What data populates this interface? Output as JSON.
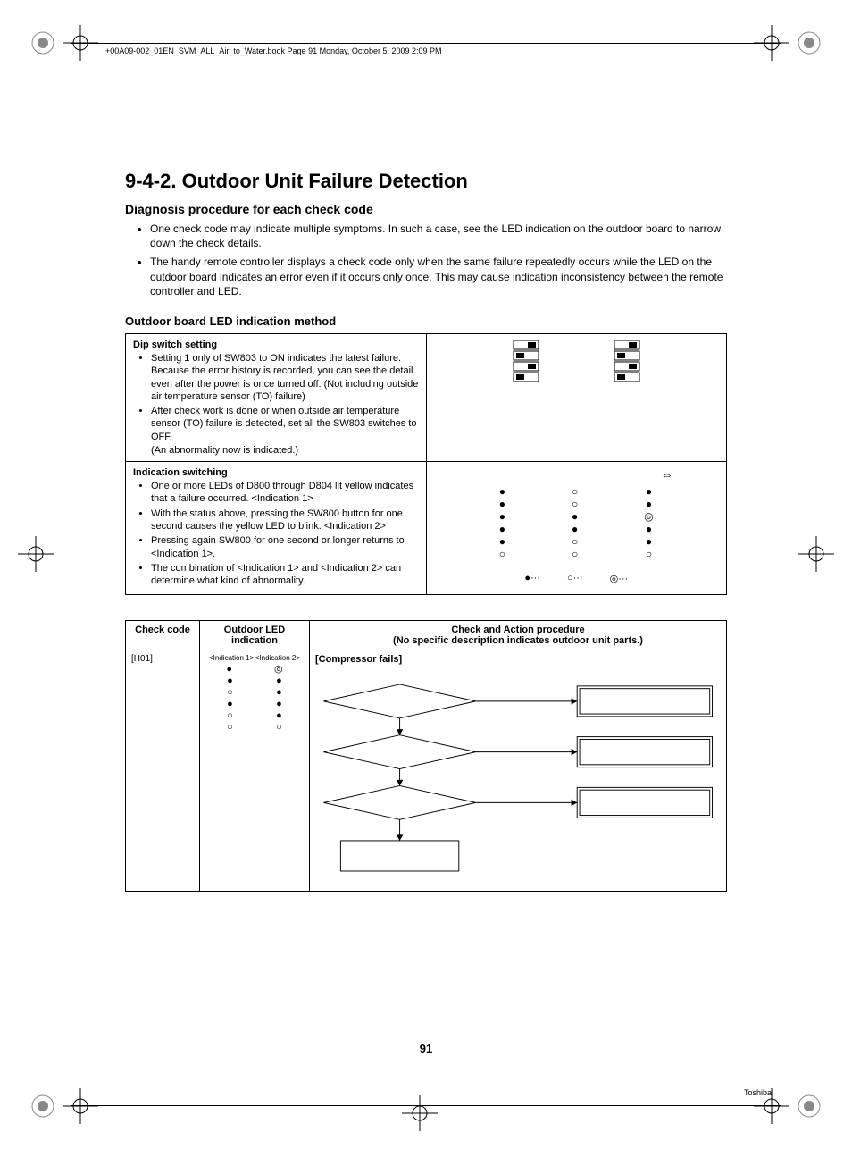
{
  "header_text": "+00A09-002_01EN_SVM_ALL_Air_to_Water.book  Page 91  Monday, October 5, 2009  2:09 PM",
  "section_number": "9-4-2.",
  "section_title": "Outdoor Unit Failure Detection",
  "subtitle": "Diagnosis procedure for each check code",
  "bullets": [
    "One check code may indicate multiple symptoms. In such a case, see the LED indication on the outdoor board to narrow down the check details.",
    "The handy remote controller displays a check code only when the same failure repeatedly occurs while the LED on the outdoor board indicates an error even if it occurs only once. This may cause indication inconsistency between the remote controller and LED."
  ],
  "outdoor_heading": "Outdoor board LED indication method",
  "dip": {
    "title": "Dip switch setting",
    "items": [
      "Setting 1 only of SW803 to ON indicates the latest failure. Because the error history is recorded, you can see the detail even after the power is once turned off. (Not including outside air temperature sensor (TO) failure)",
      "After check work is done or when outside air temperature sensor (TO) failure is detected, set all the SW803 switches to OFF.",
      "(An abnormality now is indicated.)"
    ]
  },
  "indication": {
    "title": "Indication switching",
    "items": [
      "One or more LEDs of D800 through D804 lit yellow indicates that a failure occurred. <Indication 1>",
      "With the status above, pressing the SW800 button for one second causes the yellow LED to blink. <Indication 2>",
      "Pressing again SW800 for one second or longer returns to <Indication 1>.",
      "The combination of <Indication 1> and <Indication 2> can determine what kind of abnormality."
    ]
  },
  "arrow_symbol": "⇔",
  "legend": {
    "filled": "●···",
    "open": "○···",
    "double": "◎···"
  },
  "check_table": {
    "headers": {
      "check_code": "Check code",
      "led": "Outdoor LED indication",
      "action": "Check and Action procedure",
      "action_sub": "(No specific description indicates outdoor unit parts.)"
    },
    "row": {
      "code": "[H01]",
      "ind1_label": "<Indication 1>",
      "ind2_label": "<Indication 2>",
      "flow_title": "[Compressor fails]"
    }
  },
  "page_number": "91",
  "brand": "Toshiba"
}
